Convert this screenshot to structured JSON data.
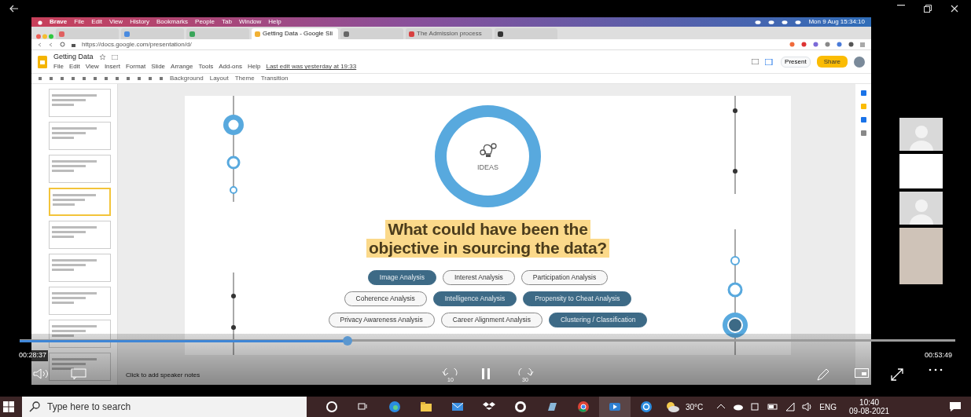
{
  "player": {
    "elapsed": "00:28:37",
    "total": "00:53:49",
    "level": 0.35,
    "skip_back": "10",
    "skip_forward": "30",
    "playing": true
  },
  "browser": {
    "app_menu": [
      "Brave",
      "File",
      "Edit",
      "View",
      "History",
      "Bookmarks",
      "People",
      "Tab",
      "Window",
      "Help"
    ],
    "clock": "Mon 9 Aug 15:34:10",
    "url": "https://docs.google.com/presentation/d/",
    "tabs": [
      {
        "selected": false
      },
      {
        "selected": false
      },
      {
        "selected": false
      },
      {
        "label": "Getting Data - Google Sli",
        "selected": true
      },
      {
        "selected": false
      },
      {
        "label": "The Admission process",
        "selected": false
      },
      {
        "selected": false
      }
    ]
  },
  "slides_app": {
    "title": "Getting Data",
    "menus": [
      "File",
      "Edit",
      "View",
      "Insert",
      "Format",
      "Slide",
      "Arrange",
      "Tools",
      "Add-ons",
      "Help"
    ],
    "last_edit": "Last edit was yesterday at 19:33",
    "toolbar": [
      "Background",
      "Layout",
      "Theme",
      "Transition"
    ],
    "present": "Present",
    "share": "Share",
    "speaker_notes": "Click to add speaker notes",
    "thumbnails": [
      {
        "selected": false
      },
      {
        "selected": false
      },
      {
        "selected": false
      },
      {
        "selected": true
      },
      {
        "selected": false
      },
      {
        "selected": false
      },
      {
        "selected": false
      },
      {
        "selected": false
      },
      {
        "selected": false
      }
    ]
  },
  "slide": {
    "badge": "IDEAS",
    "heading_lines": [
      "What could have been the",
      "objective in sourcing the data?"
    ],
    "option_rows": [
      [
        {
          "label": "Image Analysis",
          "highlighted": true
        },
        {
          "label": "Interest Analysis",
          "highlighted": false
        },
        {
          "label": "Participation Analysis",
          "highlighted": false
        }
      ],
      [
        {
          "label": "Coherence Analysis",
          "highlighted": false
        },
        {
          "label": "Intelligence Analysis",
          "highlighted": true
        },
        {
          "label": "Propensity to Cheat Analysis",
          "highlighted": true
        }
      ],
      [
        {
          "label": "Privacy Awareness Analysis",
          "highlighted": false
        },
        {
          "label": "Career Alignment Analysis",
          "highlighted": false
        },
        {
          "label": "Clustering / Classification",
          "highlighted": true
        }
      ]
    ]
  },
  "participants": [
    {
      "kind": "silhouette"
    },
    {
      "kind": "picture"
    },
    {
      "kind": "silhouette"
    },
    {
      "kind": "picture"
    }
  ],
  "taskbar": {
    "search_placeholder": "Type here to search",
    "weather": "30°C",
    "language": "ENG",
    "time": "10:40",
    "date": "09-08-2021"
  }
}
